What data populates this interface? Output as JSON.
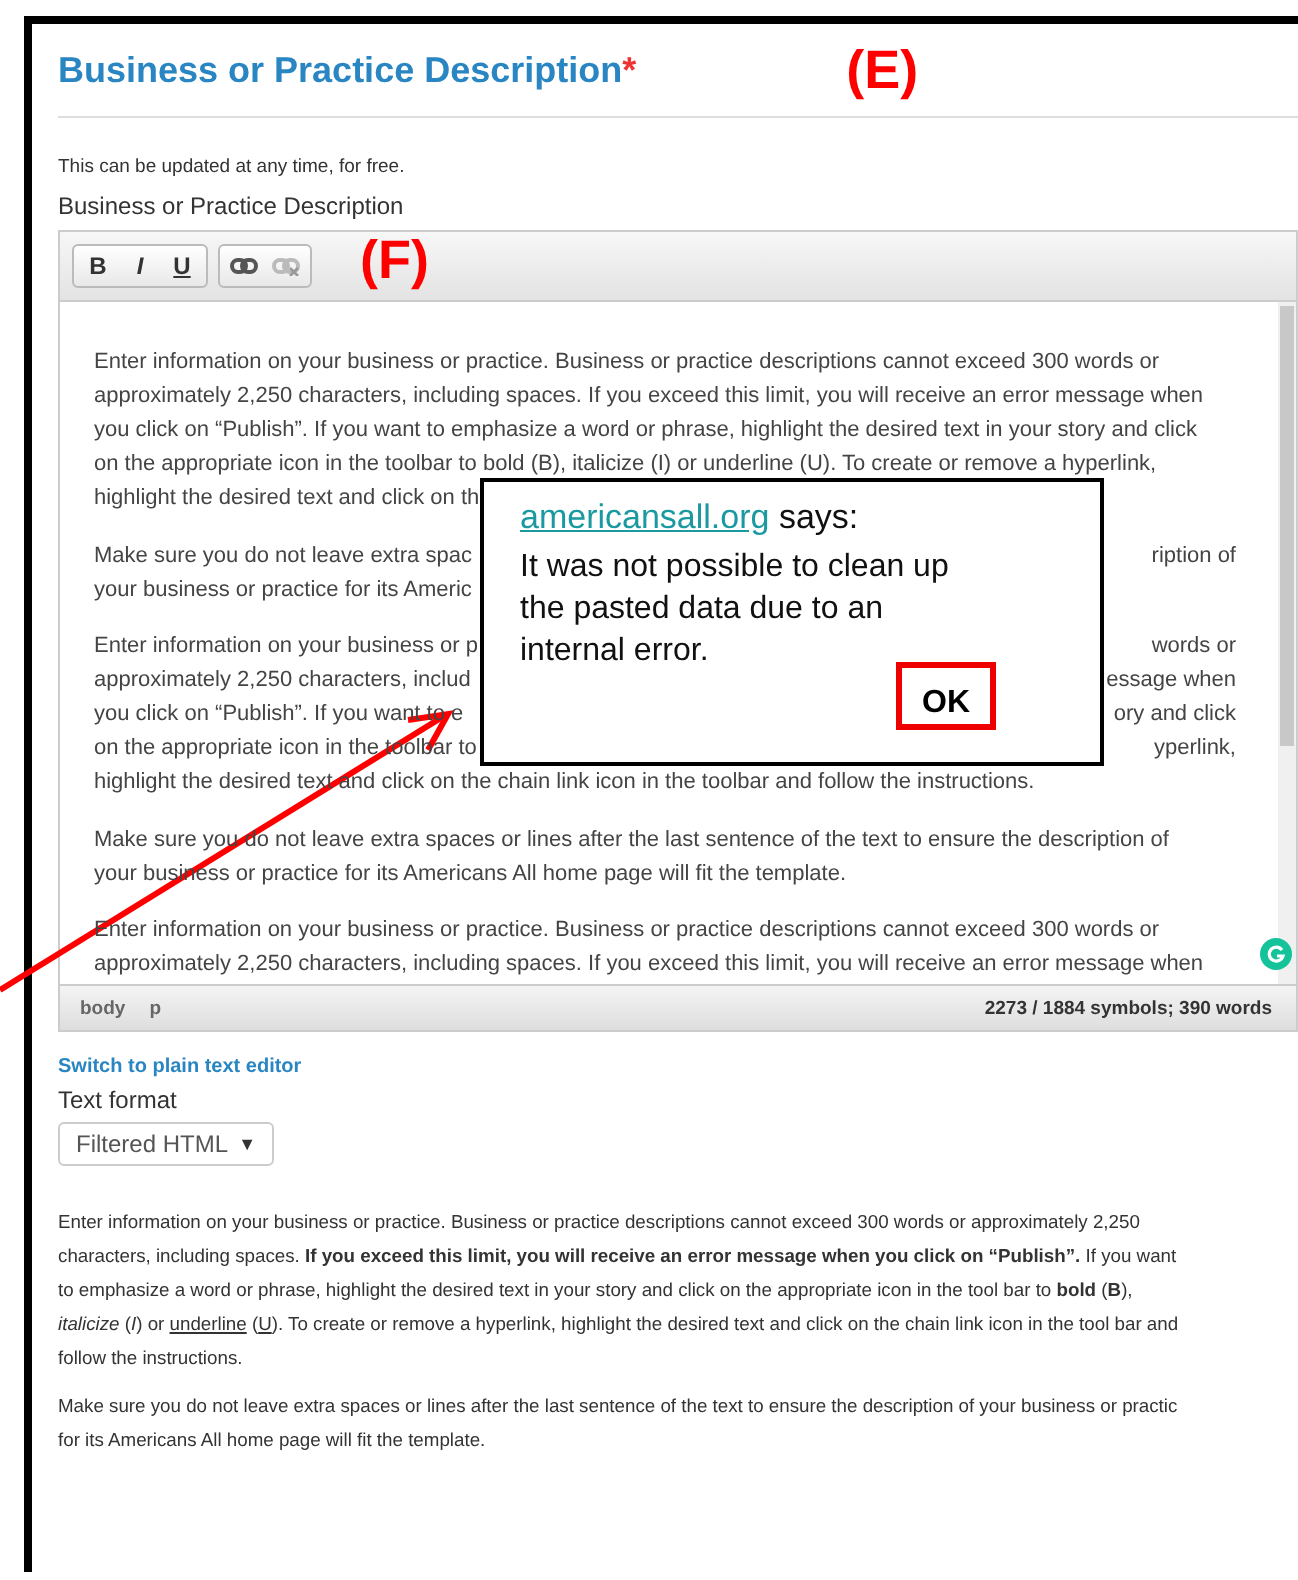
{
  "heading": {
    "title": "Business or Practice Description",
    "required_mark": "*"
  },
  "callouts": [
    "(E)",
    "(F)"
  ],
  "hint": "This can be updated at any time, for free.",
  "field_label": "Business or Practice Description",
  "toolbar": {
    "groups": [
      [
        {
          "label": "B",
          "kind": "bold",
          "disabled": false
        },
        {
          "label": "I",
          "kind": "italic",
          "disabled": false
        },
        {
          "label": "U",
          "kind": "underline",
          "disabled": false
        }
      ],
      [
        {
          "kind": "link",
          "disabled": false
        },
        {
          "kind": "unlink",
          "disabled": true
        }
      ]
    ]
  },
  "editor": {
    "paragraphs": [
      [
        {
          "left": "Enter information on your business or practice. Business or practice descriptions cannot exceed 300 words or"
        },
        {
          "left": "approximately 2,250 characters, including spaces. If you exceed this limit, you will receive an error message when"
        },
        {
          "left": "you click on “Publish”. If you want to emphasize a word or phrase, highlight the desired text in your story and click"
        },
        {
          "left": "on the appropriate icon in the toolbar to bold (B), italicize (I) or underline (U). To create or remove a hyperlink,"
        },
        {
          "left": "highlight the desired text and click on th"
        }
      ],
      [
        {
          "left": "Make sure you do not leave extra spac",
          "right": "ription of"
        },
        {
          "left": "your business or practice for its Americ"
        }
      ],
      [
        {
          "left": "Enter information on your business or p",
          "right": "words or"
        },
        {
          "left": "approximately 2,250 characters, includ",
          "right": "essage when"
        },
        {
          "left": "you click on “Publish”. If you want to e",
          "right": "ory and click"
        },
        {
          "left": "on the appropriate icon in the toolbar to",
          "right": "yperlink,"
        },
        {
          "left": "highlight the desired text and click on the chain link icon in the toolbar and follow the instructions."
        }
      ],
      [
        {
          "left": "Make sure you do not leave extra spaces or lines after the last sentence of the text to ensure the description of"
        },
        {
          "left": "your business or practice for its Americans All home page will fit the template."
        }
      ],
      [
        {
          "left": "Enter information on your business or practice. Business or practice descriptions cannot exceed 300 words or"
        },
        {
          "left": "approximately 2,250 characters, including spaces. If you exceed this limit, you will receive an error message when"
        }
      ]
    ]
  },
  "status_bar": {
    "path": [
      "body",
      "p"
    ],
    "count": "2273 / 1884 symbols; 390 words"
  },
  "plain_text_link": "Switch to plain text editor",
  "text_format": {
    "label": "Text format",
    "value": "Filtered HTML",
    "caret": "▼"
  },
  "instructions": [
    [
      [
        {
          "text": "Enter information on your business or practice. Business or practice descriptions cannot exceed 300 words or approximately 2,250",
          "underline": false
        }
      ],
      [
        {
          "text": "characters, including spaces. **If you exceed this limit, you will receive an error message when you click on “Publish”.** If you want",
          "underline": false
        }
      ],
      [
        {
          "text": "to emphasize a word or phrase, highlight the desired text in your story and click on the appropriate icon in the tool bar to **bold** (**B**),",
          "underline": false
        }
      ],
      [
        {
          "text": "*italicize* (*I*) or ",
          "underline": false
        },
        {
          "text": "underline",
          "underline": true
        },
        {
          "text": " (",
          "underline": false
        },
        {
          "text": "U",
          "underline": true
        },
        {
          "text": "). To create or remove a hyperlink, highlight the desired text and click on the chain link icon in the tool bar and",
          "underline": false
        }
      ],
      [
        {
          "text": "follow the instructions.",
          "underline": false
        }
      ]
    ],
    [
      [
        {
          "text": "Make sure you do not leave extra spaces or lines after the last sentence of the text to ensure the description of your business or practic",
          "underline": false
        }
      ],
      [
        {
          "text": "for its Americans All home page will fit the template.",
          "underline": false
        }
      ]
    ]
  ],
  "dialog": {
    "site": "americansall.org",
    "says": "says:",
    "message": "It was not possible to clean up the pasted data due to an internal error.",
    "button": "OK"
  }
}
